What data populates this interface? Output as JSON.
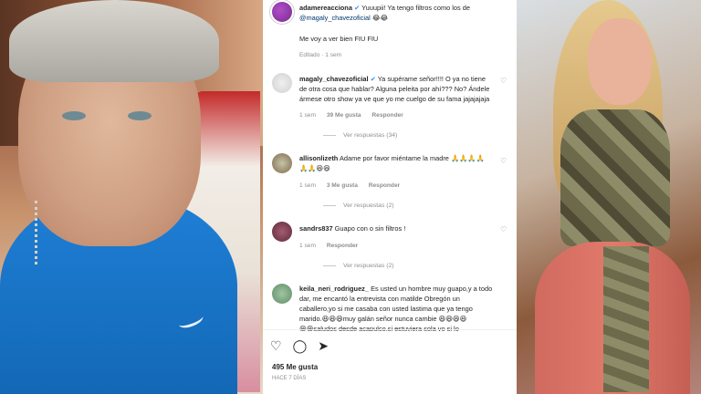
{
  "caption": {
    "username": "adamereacciona",
    "text_line1": "Yuuupii! Ya tengo filtros como los de",
    "mention": "@magaly_chavezoficial",
    "emojis1": "😂😂",
    "text_line2": "Me voy a ver bien FIU FIU",
    "meta": "Editado · 1 sem"
  },
  "comments": [
    {
      "username": "magaly_chavezoficial",
      "lines": [
        "Ya supérame señor!!!! O ya no tiene",
        "de otra cosa que hablar? Alguna peleita por ahí??? No? Ándele",
        "ármese otro show ya ve que yo me cuelgo de su fama jajajajaja"
      ],
      "time": "1 sem",
      "likes": "39 Me gusta",
      "reply": "Responder",
      "view_replies": "Ver respuestas (34)"
    },
    {
      "username": "allisonlizeth",
      "lines": [
        "Adame por favor miéntame la madre 🙏🙏🙏🙏",
        "🙏🙏😆😆"
      ],
      "time": "1 sem",
      "likes": "3 Me gusta",
      "reply": "Responder",
      "view_replies": "Ver respuestas (2)"
    },
    {
      "username": "sandrs837",
      "lines": [
        "Guapo con o sin filtros !"
      ],
      "time": "1 sem",
      "likes": "",
      "reply": "Responder",
      "view_replies": "Ver respuestas (2)"
    },
    {
      "username": "keila_neri_rodriguez_",
      "lines": [
        "Es usted un hombre muy guapo,y a todo",
        "dar, me encantó la entrevista con matilde Obregón un",
        "caballero,yo si me casaba con usted lastima que ya tengo",
        "marido.😆😆😆muy galán señor nunca cambie 😆😆😆😆",
        "😆😆saludos desde acapulco,si estuviera sola vo si lo"
      ]
    }
  ],
  "actions": {
    "like_icon": "♡",
    "comment_icon": "◯",
    "share_icon": "➤"
  },
  "likes": "495 Me gusta",
  "ago": "Hace 7 días"
}
